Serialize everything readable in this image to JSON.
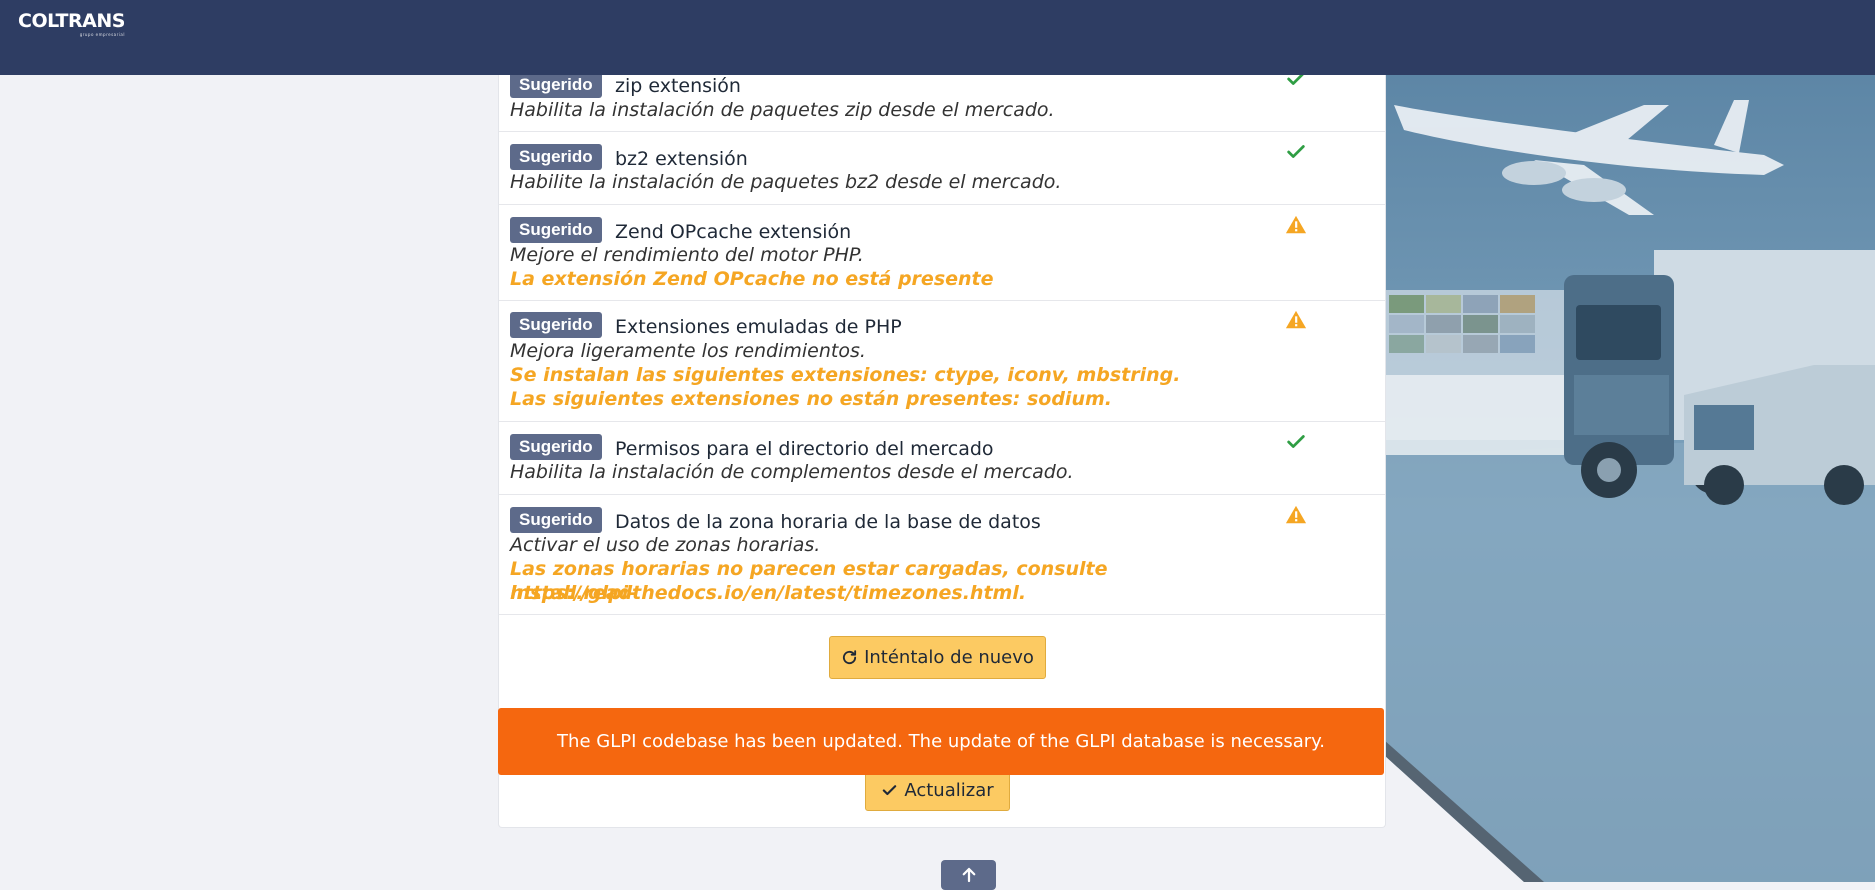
{
  "brand": {
    "name": "COLTRANS",
    "tagline": "grupo empresarial"
  },
  "badge_label": "Sugerido",
  "requirements": [
    {
      "title": "zip extensión",
      "description": "Habilita la instalación de paquetes zip desde el mercado.",
      "status": "ok",
      "messages": []
    },
    {
      "title": "bz2 extensión",
      "description": "Habilite la instalación de paquetes bz2 desde el mercado.",
      "status": "ok",
      "messages": []
    },
    {
      "title": "Zend OPcache extensión",
      "description": "Mejore el rendimiento del motor PHP.",
      "status": "warning",
      "messages": [
        "La extensión Zend OPcache no está presente"
      ]
    },
    {
      "title": "Extensiones emuladas de PHP",
      "description": "Mejora ligeramente los rendimientos.",
      "status": "warning",
      "messages": [
        "Se instalan las siguientes extensiones: ctype, iconv, mbstring.",
        "Las siguientes extensiones no están presentes: sodium."
      ]
    },
    {
      "title": "Permisos para el directorio del mercado",
      "description": "Habilita la instalación de complementos desde el mercado.",
      "status": "ok",
      "messages": []
    },
    {
      "title": "Datos de la zona horaria de la base de datos",
      "description": "Activar el uso de zonas horarias.",
      "status": "warning",
      "messages": [
        "Las zonas horarias no parecen estar cargadas, consulte https://glpi-",
        "install.readthedocs.io/en/latest/timezones.html."
      ]
    }
  ],
  "buttons": {
    "retry_label": "Inténtalo de nuevo",
    "update_label": "Actualizar"
  },
  "alert": {
    "message": "The GLPI codebase has been updated. The update of the GLPI database is necessary."
  },
  "colors": {
    "navbar": "#2e3d63",
    "badge": "#5d6a8a",
    "ok": "#2f9e44",
    "warning": "#f5a623",
    "alert": "#f5670f",
    "button": "#fcca62"
  }
}
